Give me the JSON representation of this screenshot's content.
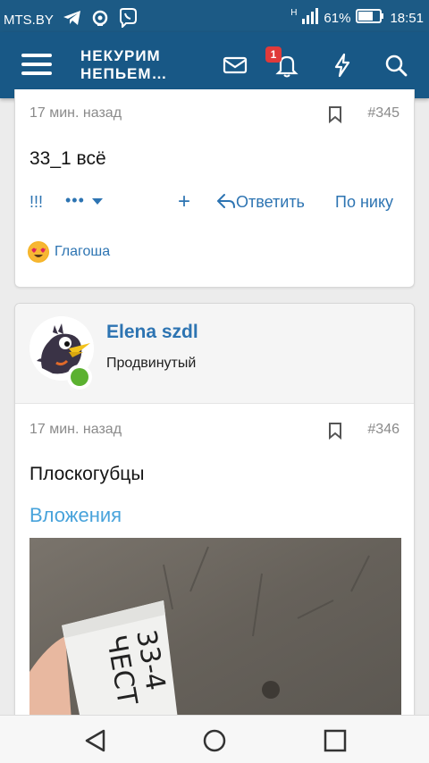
{
  "status_bar": {
    "carrier": "MTS.BY",
    "network": "H",
    "battery": "61%",
    "time": "18:51",
    "icons": [
      "telegram-icon",
      "signal-app-icon",
      "viber-icon",
      "cellular-signal-icon",
      "battery-icon"
    ]
  },
  "header": {
    "logo_line1": "НЕКУРИМ",
    "logo_line2": "НЕПЬЕМ…",
    "notification_count": "1",
    "icons": [
      "menu-icon",
      "inbox-icon",
      "bell-icon",
      "bolt-icon",
      "search-icon"
    ]
  },
  "post1": {
    "time": "17 мин. назад",
    "number": "#345",
    "text": "33_1 всё",
    "actions": {
      "exclaim": "!!!",
      "more": "•••",
      "plus": "+",
      "reply": "Ответить",
      "by_nick": "По нику"
    },
    "reaction_user": "Глагоша"
  },
  "post2": {
    "username": "Elena szdl",
    "user_title": "Продвинутый",
    "time": "17 мин. назад",
    "number": "#346",
    "text": "Плоскогубцы",
    "attachments_title": "Вложения",
    "photo_note": "33-4\nЧЕСТ"
  },
  "colors": {
    "header": "#185886",
    "link": "#2d74b2",
    "attachments": "#48a3db",
    "online": "#5bb130",
    "badge": "#e03a3a"
  }
}
